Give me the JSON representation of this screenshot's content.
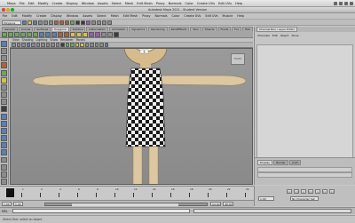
{
  "menubar": {
    "items": [
      "Maya",
      "File",
      "Edit",
      "Modify",
      "Create",
      "Display",
      "Window",
      "Assets",
      "Select",
      "Mesh",
      "Edit Mesh",
      "Proxy",
      "Normals",
      "Color",
      "Create UVs",
      "Edit UVs",
      "Help"
    ]
  },
  "titlebar": {
    "title": "Autodesk Maya 2011 - Student Version"
  },
  "appmenu": {
    "items": [
      "File",
      "Edit",
      "Modify",
      "Create",
      "Display",
      "Window",
      "Assets",
      "Select",
      "Mesh",
      "Edit Mesh",
      "Proxy",
      "Normals",
      "Color",
      "Create UVs",
      "Edit UVs",
      "Muscle",
      "Help"
    ]
  },
  "statusline": {
    "mode": "Polygons"
  },
  "shelf": {
    "tabs": [
      "General",
      "Curves",
      "Surfaces",
      "Polygons",
      "Subdivs",
      "Deformation",
      "Animation",
      "Dynamics",
      "Rendering",
      "PaintEffects",
      "Toon",
      "Muscle",
      "Fluids",
      "Fur",
      "Hair",
      "nCloth",
      "Custom"
    ],
    "active_tab_index": 3
  },
  "viewport": {
    "menu": [
      "View",
      "Shading",
      "Lighting",
      "Show",
      "Renderer",
      "Panels"
    ],
    "cube_label": "FRONT"
  },
  "channelbox": {
    "tabs": [
      "Channel Box / Layer Editor"
    ],
    "menu": [
      "Channels",
      "Edit",
      "Object",
      "Show"
    ],
    "object_name": "",
    "layer_tabs": [
      "Display",
      "Render",
      "Anim"
    ]
  },
  "timeline": {
    "ticks": [
      "1",
      "2",
      "4",
      "6",
      "8",
      "10",
      "12",
      "14",
      "16",
      "18",
      "20",
      "22",
      "24"
    ],
    "current_frame": "1.00",
    "range_start": "1.00",
    "range_start_inner": "1.00",
    "range_end_inner": "24.00",
    "range_end": "48.00"
  },
  "playback": {
    "buttons": [
      "|<",
      "<|",
      "<",
      "|>",
      ">",
      "|>",
      ">|"
    ],
    "current_field": "1.00",
    "char_set": "No Character Set"
  },
  "cmdline": {
    "label": "MEL"
  },
  "helpline": {
    "text": "Select Tool: select an object"
  },
  "colors": {
    "skin": "#dcc7a0",
    "viewport_bg": "#929292",
    "dress_dark": "#1a1a1a",
    "dress_light": "#f2f2f2"
  }
}
